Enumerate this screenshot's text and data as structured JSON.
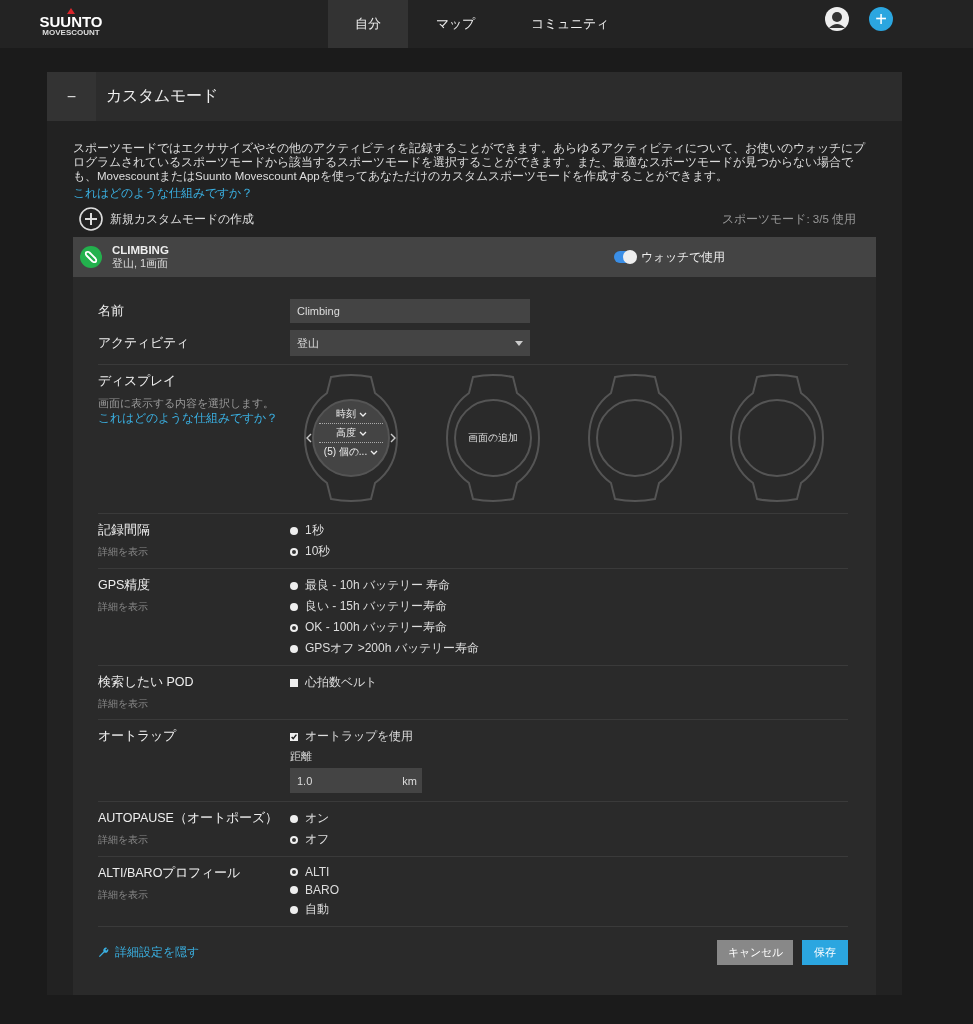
{
  "nav": {
    "logo": "SUUNTO",
    "logo_sub": "MOVESCOUNT",
    "tabs": [
      {
        "label": "自分",
        "selected": true
      },
      {
        "label": "マップ",
        "selected": false
      },
      {
        "label": "コミュニティ",
        "selected": false
      }
    ],
    "add_icon": "+"
  },
  "panel": {
    "collapse": "−",
    "title": "カスタムモード"
  },
  "intro": {
    "text": "スポーツモードではエクササイズやその他のアクティビティを記録することができます。あらゆるアクティビティについて、お使いのウォッチにプログラムされているスポーツモードから該当するスポーツモードを選択することができます。また、最適なスポーツモードが見つからない場合でも、MovescountまたはSuunto Movescount Appを使ってあなただけのカスタムスポーツモードを作成することができます。",
    "link": "これはどのような仕組みですか？"
  },
  "create": {
    "label": "新規カスタムモードの作成"
  },
  "usage": "スポーツモード: 3/5 使用",
  "mode": {
    "name": "CLIMBING",
    "subtitle": "登山, 1画面",
    "toggle": {
      "label": "ウォッチで使用",
      "on": true
    }
  },
  "form": {
    "name": {
      "label": "名前",
      "value": "Climbing"
    },
    "activity": {
      "label": "アクティビティ",
      "value": "登山"
    },
    "display": {
      "label": "ディスプレイ",
      "hint": "画面に表示する内容を選択します。",
      "link": "これはどのような仕組みですか？",
      "screens": [
        {
          "kind": "fields",
          "fields": [
            "時刻",
            "高度",
            "(5) 個の..."
          ]
        },
        {
          "kind": "add",
          "label": "画面の追加"
        },
        {
          "kind": "empty"
        },
        {
          "kind": "empty"
        }
      ]
    },
    "settings": [
      {
        "kind": "radio",
        "label": "記録間隔",
        "detail": "詳細を表示",
        "options": [
          {
            "label": "1秒",
            "selected": false
          },
          {
            "label": "10秒",
            "selected": true
          }
        ]
      },
      {
        "kind": "radio",
        "label": "GPS精度",
        "detail": "詳細を表示",
        "options": [
          {
            "label": "最良 - 10h バッテリー 寿命",
            "selected": false
          },
          {
            "label": "良い - 15h バッテリー寿命",
            "selected": false
          },
          {
            "label": "OK - 100h バッテリー寿命",
            "selected": true
          },
          {
            "label": "GPSオフ >200h バッテリー寿命",
            "selected": false
          }
        ]
      },
      {
        "kind": "checkbox",
        "label": "検索したい POD",
        "detail": "詳細を表示",
        "options": [
          {
            "label": "心拍数ベルト",
            "checked": false
          }
        ]
      },
      {
        "kind": "autolap",
        "label": "オートラップ",
        "checkbox": {
          "label": "オートラップを使用",
          "checked": true
        },
        "distance_label": "距離",
        "distance": "1.0",
        "unit": "km"
      },
      {
        "kind": "radio",
        "label": "AUTOPAUSE（オートポーズ）",
        "detail": "詳細を表示",
        "options": [
          {
            "label": "オン",
            "selected": false
          },
          {
            "label": "オフ",
            "selected": true
          }
        ]
      },
      {
        "kind": "radio",
        "label": "ALTI/BAROプロフィール",
        "detail": "詳細を表示",
        "options": [
          {
            "label": "ALTI",
            "selected": true
          },
          {
            "label": "BARO",
            "selected": false
          },
          {
            "label": "自動",
            "selected": false
          }
        ]
      }
    ]
  },
  "footer": {
    "advanced_link": "詳細設定を隠す",
    "buttons": [
      {
        "label": "キャンセル",
        "kind": "secondary"
      },
      {
        "label": "保存",
        "kind": "primary"
      }
    ]
  }
}
